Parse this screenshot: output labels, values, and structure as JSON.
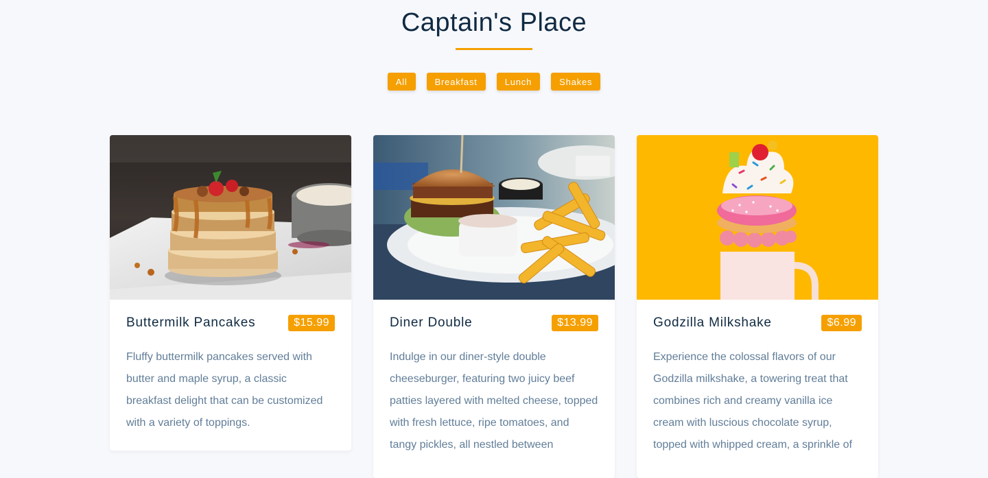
{
  "header": {
    "title": "Captain's Place"
  },
  "filters": {
    "items": [
      "All",
      "Breakfast",
      "Lunch",
      "Shakes"
    ]
  },
  "menu": {
    "items": [
      {
        "name": "Buttermilk Pancakes",
        "price": "$15.99",
        "image": "pancakes-photo",
        "description": "Fluffy buttermilk pancakes served with butter and maple syrup, a classic breakfast delight that can be customized with a variety of toppings."
      },
      {
        "name": "Diner Double",
        "price": "$13.99",
        "image": "burger-photo",
        "description": "Indulge in our diner-style double cheeseburger, featuring two juicy beef patties layered with melted cheese, topped with fresh lettuce, ripe tomatoes, and tangy pickles, all nestled between"
      },
      {
        "name": "Godzilla Milkshake",
        "price": "$6.99",
        "image": "milkshake-photo",
        "description": "Experience the colossal flavors of our Godzilla milkshake, a towering treat that combines rich and creamy vanilla ice cream with luscious chocolate syrup, topped with whipped cream, a sprinkle of"
      }
    ]
  },
  "colors": {
    "accent": "#f59f00",
    "heading": "#102a42",
    "body_text": "#617d98",
    "background": "#f7f8fc"
  }
}
